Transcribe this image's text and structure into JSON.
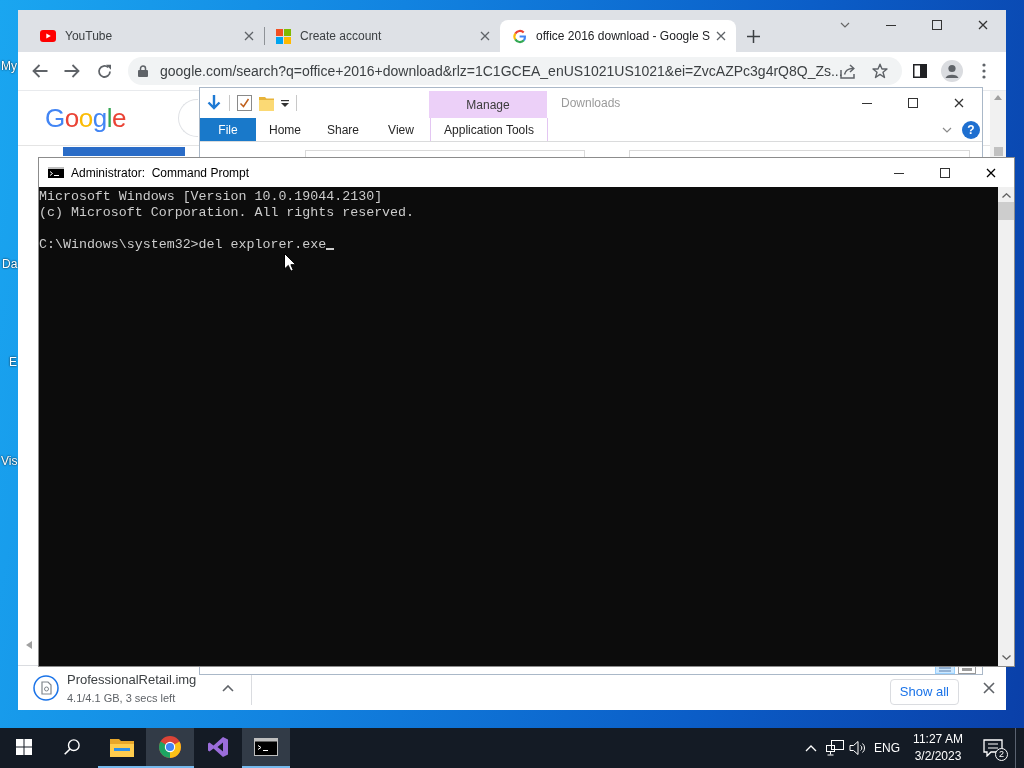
{
  "desktop": {
    "icons": [
      {
        "label": "My"
      },
      {
        "label": "Da"
      },
      {
        "label": "E"
      },
      {
        "label": "Vis"
      }
    ]
  },
  "browser": {
    "tabs": [
      {
        "kind": "video",
        "title": "YouTube",
        "selected": false
      },
      {
        "kind": "account",
        "title": "Create account",
        "selected": false
      },
      {
        "kind": "search",
        "title": "office 2016 download - Google S",
        "selected": true
      }
    ],
    "url": "google.com/search?q=office+2016+download&rlz=1C1GCEA_enUS1021US1021&ei=ZvcAZPc3g4rQ8Q_Zs...",
    "page": {
      "logo": "Google"
    },
    "download_bar": {
      "file_name": "ProfessionalRetail.img",
      "progress": "4.1/4.1 GB, 3 secs left",
      "show_all": "Show all"
    }
  },
  "explorer": {
    "title": "Downloads",
    "context_tab": "Manage",
    "ribbon_tabs": [
      {
        "kind": "file",
        "label": "File"
      },
      {
        "kind": "tab",
        "label": "Home"
      },
      {
        "kind": "tab",
        "label": "Share"
      },
      {
        "kind": "tab",
        "label": "View"
      },
      {
        "kind": "context",
        "label": "Application Tools"
      }
    ],
    "help": "?"
  },
  "command_prompt": {
    "title": "Administrator:  Command Prompt",
    "output": [
      "Microsoft Windows [Version 10.0.19044.2130]",
      "(c) Microsoft Corporation. All rights reserved."
    ],
    "prompt": "C:\\Windows\\system32>del explorer.exe"
  },
  "taskbar": {
    "apps": [
      {
        "kind": "files",
        "running": true,
        "highlighted": false
      },
      {
        "kind": "browser",
        "running": true,
        "highlighted": true
      },
      {
        "kind": "ide",
        "running": false,
        "highlighted": false
      },
      {
        "kind": "terminal",
        "running": true,
        "highlighted": true
      }
    ],
    "language": "ENG",
    "time": "11:27 AM",
    "date": "3/2/2023",
    "notification_count": "2"
  }
}
